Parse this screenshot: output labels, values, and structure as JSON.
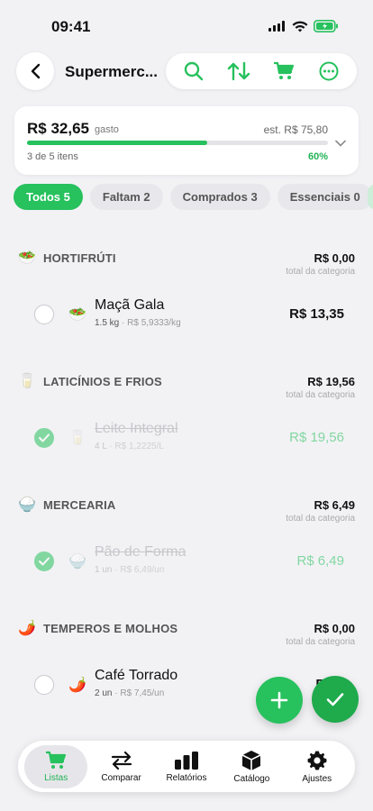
{
  "status_bar": {
    "time": "09:41"
  },
  "header": {
    "title": "Supermerc...",
    "icons": [
      "search-icon",
      "sort-icon",
      "cart-icon",
      "more-icon"
    ]
  },
  "summary": {
    "amount": "R$ 32,65",
    "amount_suffix": "gasto",
    "estimate": "est. R$ 75,80",
    "items_count": "3 de 5 itens",
    "percent": "60%",
    "progress": 0.6
  },
  "filters": [
    "Todos 5",
    "Faltam 2",
    "Comprados 3",
    "Essenciais 0"
  ],
  "colors": {
    "accent": "#27c15d"
  },
  "categories": [
    {
      "emoji": "🥗",
      "name": "HORTIFRÚTI",
      "total": "R$ 0,00",
      "total_label": "total da categoria",
      "item": {
        "emoji": "🥗",
        "name": "Maçã Gala",
        "qty": "1.5 kg",
        "unit_price": "R$ 5,9333/kg",
        "price": "R$ 13,35",
        "done": false
      }
    },
    {
      "emoji": "🥛",
      "name": "LATICÍNIOS E FRIOS",
      "total": "R$ 19,56",
      "total_label": "total da categoria",
      "item": {
        "emoji": "🥛",
        "name": "Leite Integral",
        "qty": "4 L",
        "unit_price": "R$ 1,2225/L",
        "price": "R$ 19,56",
        "done": true
      }
    },
    {
      "emoji": "🍚",
      "name": "MERCEARIA",
      "total": "R$ 6,49",
      "total_label": "total da categoria",
      "item": {
        "emoji": "🍚",
        "name": "Pão de Forma",
        "qty": "1 un",
        "unit_price": "R$ 6,49/un",
        "price": "R$ 6,49",
        "done": true
      }
    },
    {
      "emoji": "🌶️",
      "name": "TEMPEROS E MOLHOS",
      "total": "R$ 0,00",
      "total_label": "total da categoria",
      "item": {
        "emoji": "🌶️",
        "name": "Café Torrado",
        "qty": "2 un",
        "unit_price": "R$ 7,45/un",
        "price": "R$ 2",
        "done": false
      }
    }
  ],
  "tabbar": [
    {
      "label": "Listas",
      "icon": "cart-icon",
      "active": true
    },
    {
      "label": "Comparar",
      "icon": "compare-icon",
      "active": false
    },
    {
      "label": "Relatórios",
      "icon": "chart-icon",
      "active": false
    },
    {
      "label": "Catálogo",
      "icon": "box-icon",
      "active": false
    },
    {
      "label": "Ajustes",
      "icon": "gear-icon",
      "active": false
    }
  ]
}
